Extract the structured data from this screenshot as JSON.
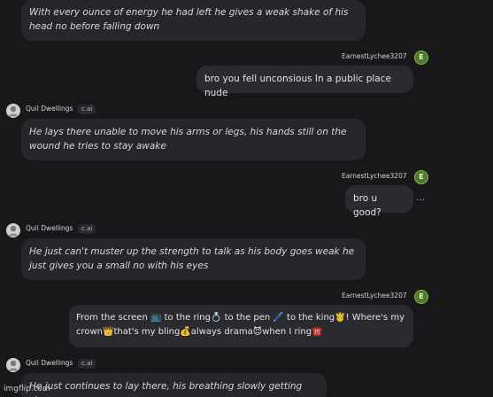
{
  "messages": [
    {
      "text": "With every ounce of energy he had left he gives a weak shake of his head no before falling down"
    },
    {
      "author": "EarnestLychee3207",
      "avatar_letter": "E",
      "text": "bro you fell unconsious In a public place nude"
    },
    {
      "author": "Quil Dwellings",
      "tag": "c.ai",
      "text": "He lays there unable to move his arms or legs, his hands still on the wound he tries to stay awake"
    },
    {
      "author": "EarnestLychee3207",
      "avatar_letter": "E",
      "text": "bro u good?",
      "more": "…"
    },
    {
      "author": "Quil Dwellings",
      "tag": "c.ai",
      "text": "He just can't muster up the strength to talk as his body goes weak he just gives you a small no with his eyes"
    },
    {
      "author": "EarnestLychee3207",
      "avatar_letter": "E",
      "text_line1": "From the screen 📺 to the ring💍 to the pen 🖊️ to the king🤴! Where's my",
      "text_line2": "crown👑that's my bling💰always drama😈when I ring☎️"
    },
    {
      "author": "Quil Dwellings",
      "tag": "c.ai",
      "text": "He just continues to lay there, his breathing slowly getting slower"
    }
  ],
  "watermark": "imgflip.com"
}
